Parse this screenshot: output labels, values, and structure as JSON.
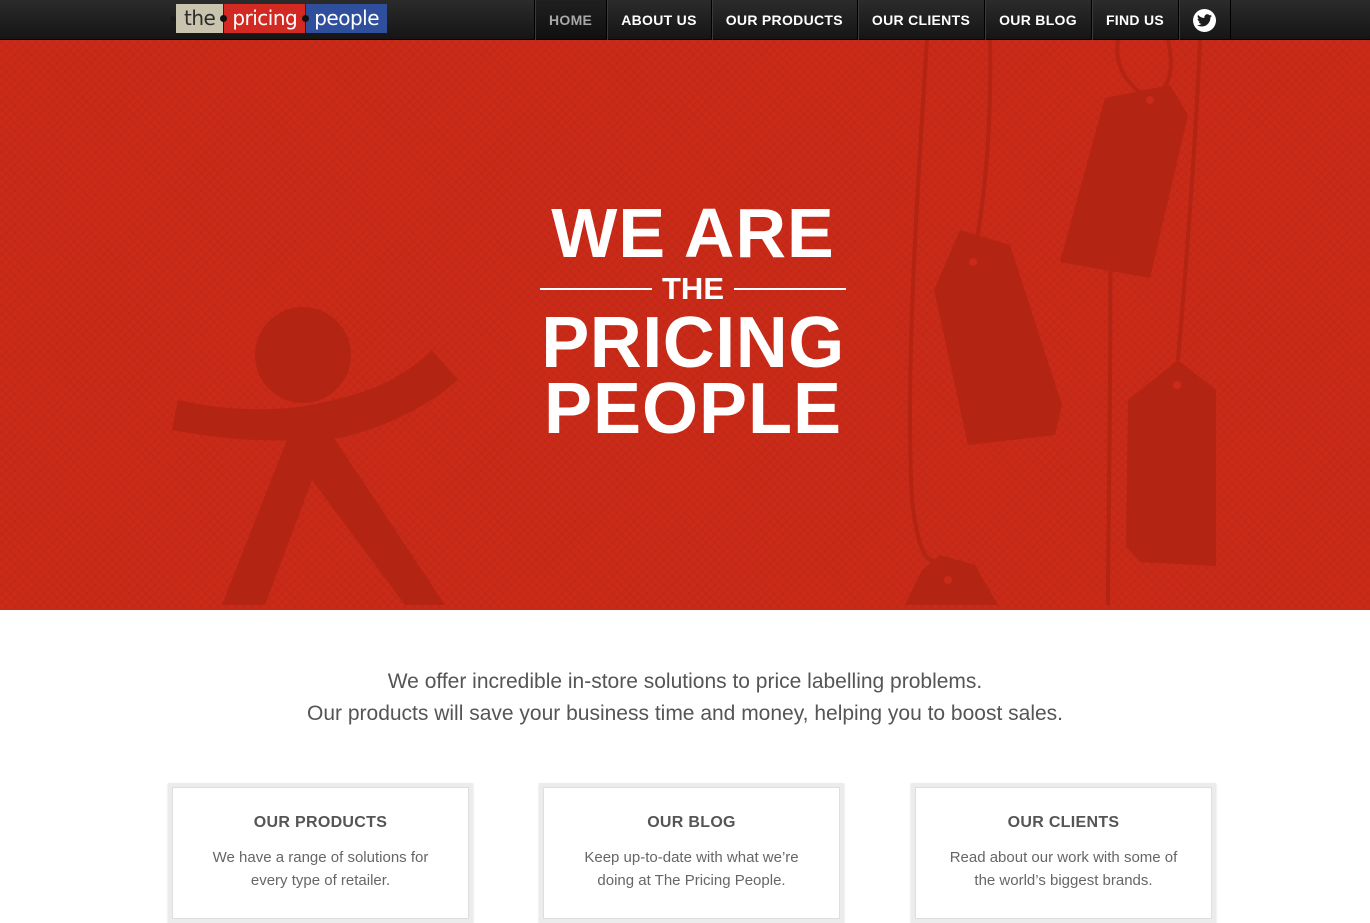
{
  "logo": {
    "part1": "the",
    "part2": "pricing",
    "part3": "people"
  },
  "nav": {
    "items": [
      {
        "label": "HOME",
        "active": true
      },
      {
        "label": "ABOUT US",
        "active": false
      },
      {
        "label": "OUR PRODUCTS",
        "active": false
      },
      {
        "label": "OUR CLIENTS",
        "active": false
      },
      {
        "label": "OUR BLOG",
        "active": false
      },
      {
        "label": "FIND US",
        "active": false
      }
    ],
    "twitter_icon": "twitter-icon"
  },
  "hero": {
    "line1": "WE ARE",
    "line2": "THE",
    "line3": "PRICING",
    "line4": "PEOPLE",
    "background_color": "#cc2a18"
  },
  "intro": {
    "line1": "We offer incredible in-store solutions to price labelling problems.",
    "line2": "Our products will save your business time and money, helping you to boost sales."
  },
  "cards": [
    {
      "title": "OUR PRODUCTS",
      "line1": "We have a range of solutions for",
      "line2": "every type of retailer."
    },
    {
      "title": "OUR BLOG",
      "line1": "Keep up-to-date with what we’re",
      "line2": "doing at The Pricing People."
    },
    {
      "title": "OUR CLIENTS",
      "line1": "Read about our work with some of",
      "line2": "the world’s biggest brands."
    }
  ]
}
